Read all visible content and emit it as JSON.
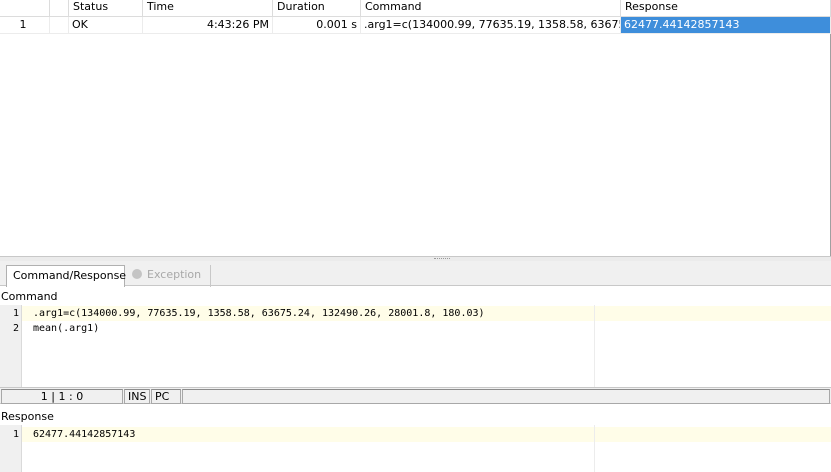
{
  "log_table": {
    "columns": [
      "Status",
      "Time",
      "Duration",
      "Command",
      "Response"
    ],
    "rows": [
      {
        "index": "1",
        "status": "OK",
        "time": "4:43:26 PM",
        "duration": "0.001 s",
        "command": ".arg1=c(134000.99, 77635.19, 1358.58, 63675.2...",
        "response": "62477.44142857143"
      }
    ]
  },
  "tabs": {
    "command_response": "Command/Response",
    "exception": "Exception"
  },
  "command_section": {
    "label": "Command",
    "lines": [
      ".arg1=c(134000.99, 77635.19, 1358.58, 63675.24, 132490.26, 28001.8, 180.03)",
      "mean(.arg1)"
    ],
    "line_numbers": [
      "1",
      "2"
    ]
  },
  "status_bar": {
    "position": "1 | 1 : 0",
    "insert_mode": "INS",
    "line_ending": "PC"
  },
  "response_section": {
    "label": "Response",
    "lines": [
      "62477.44142857143"
    ],
    "line_numbers": [
      "1"
    ]
  },
  "colors": {
    "selection": "#3e8edb",
    "current_line": "#fffde8"
  }
}
